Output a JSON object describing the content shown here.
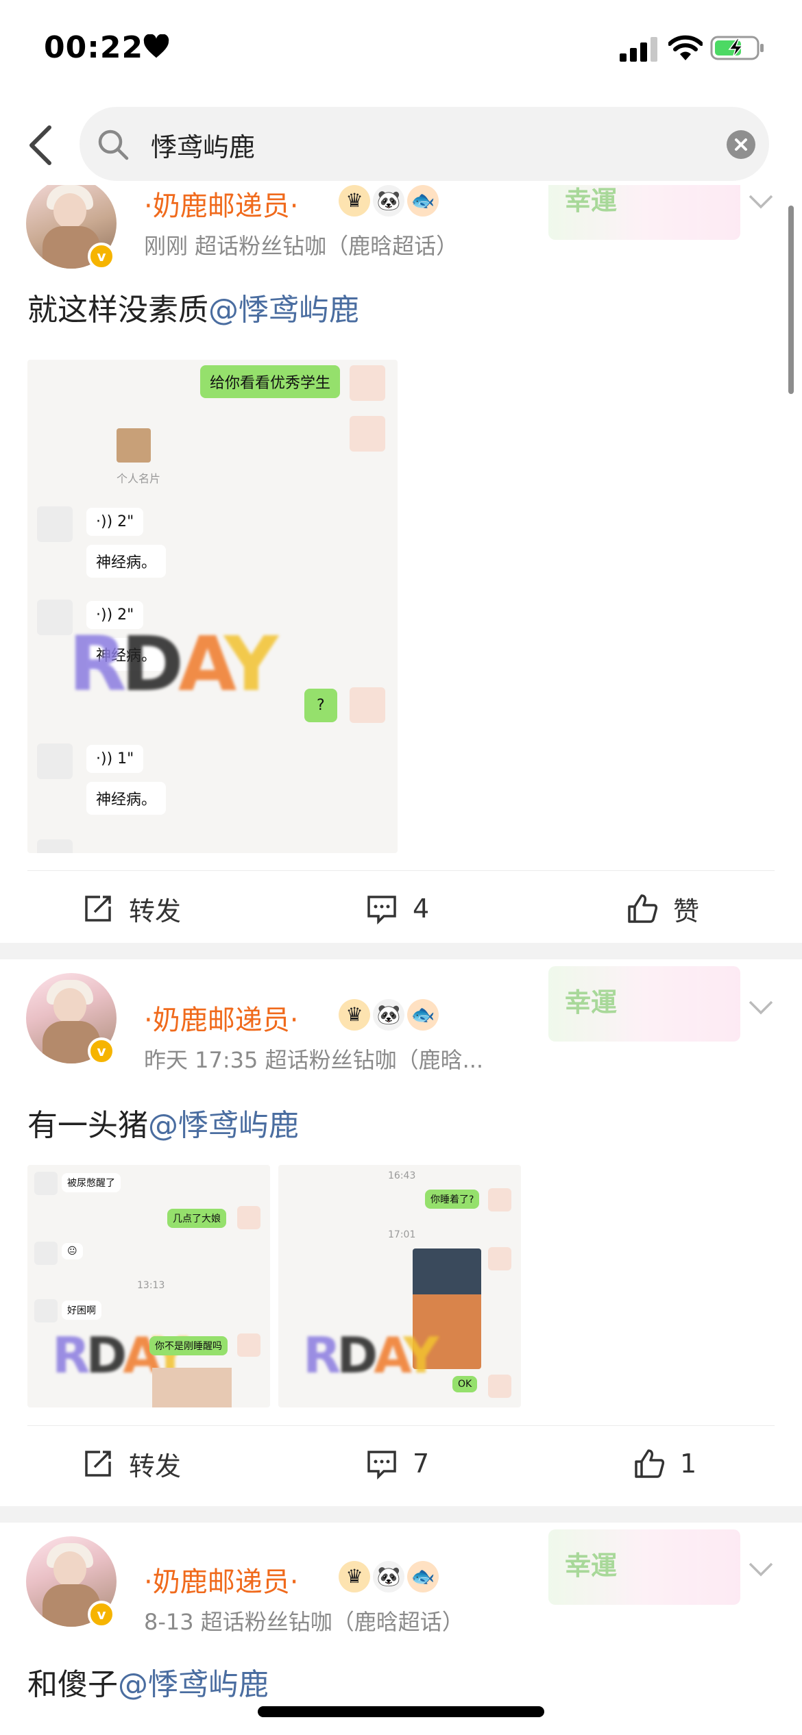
{
  "status": {
    "time": "00:22"
  },
  "search": {
    "query": "悸鸢屿鹿"
  },
  "posts": [
    {
      "username": "·奶鹿邮递员·",
      "meta": "刚刚  超话粉丝钻咖（鹿晗超话）",
      "text_prefix": "就这样没素质",
      "mention": "@悸鸢屿鹿",
      "sticker_text": "幸運",
      "chat": {
        "msg1": "给你看看优秀学生",
        "card_label": "个人名片",
        "voice1": "·)) 2\"",
        "reply1": "神经病。",
        "voice2": "·)) 2\"",
        "reply2": "神经病。",
        "q": "?",
        "voice3": "·)) 1\"",
        "reply3": "神经病。"
      },
      "actions": {
        "repost": "转发",
        "comments": "4",
        "like": "赞"
      }
    },
    {
      "username": "·奶鹿邮递员·",
      "meta": "昨天 17:35  超话粉丝钻咖（鹿晗...",
      "text_prefix": "有一头猪",
      "mention": "@悸鸢屿鹿",
      "sticker_text": "幸運",
      "chat_a": {
        "m1": "被尿憋醒了",
        "m2": "几点了大娘",
        "m3": "😐",
        "time": "13:13",
        "m4": "好困啊",
        "m5": "你不是刚睡醒吗"
      },
      "chat_b": {
        "time1": "16:43",
        "m1": "你睡着了?",
        "time2": "17:01",
        "m2": "OK"
      },
      "actions": {
        "repost": "转发",
        "comments": "7",
        "like": "1"
      }
    },
    {
      "username": "·奶鹿邮递员·",
      "meta": "8-13  超话粉丝钻咖（鹿晗超话）",
      "text_prefix": "和傻子",
      "mention": "@悸鸢屿鹿",
      "sticker_text": "幸運"
    }
  ],
  "colors": {
    "username": "#f06a1c",
    "mention": "#4a6da0",
    "bubble_green": "#95e06c"
  }
}
